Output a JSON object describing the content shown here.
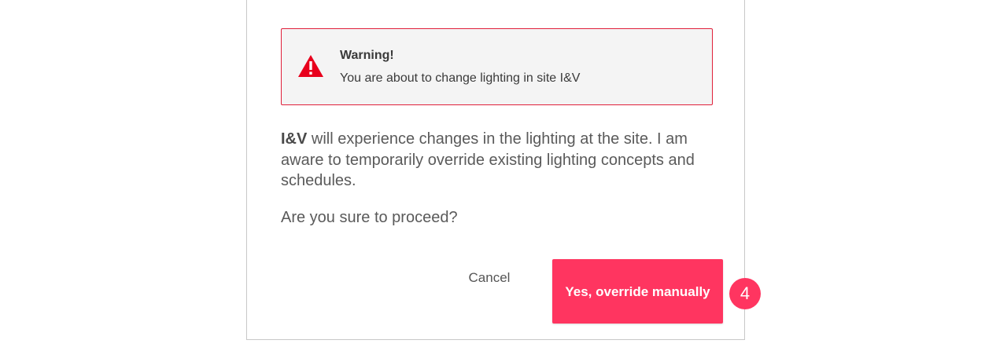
{
  "alert": {
    "icon": "warning-triangle-icon",
    "title": "Warning!",
    "message": "You are about to change lighting in site I&V",
    "accent_color": "#e0203a"
  },
  "body": {
    "site_name": "I&V",
    "description": "will experience changes in the lighting at the site. I am aware to temporarily override existing lighting concepts and schedules.",
    "question": "Are you sure to proceed?"
  },
  "actions": {
    "cancel_label": "Cancel",
    "confirm_label": "Yes, override manually",
    "confirm_color": "#ff3560"
  },
  "annotation": {
    "step_number": "4"
  }
}
